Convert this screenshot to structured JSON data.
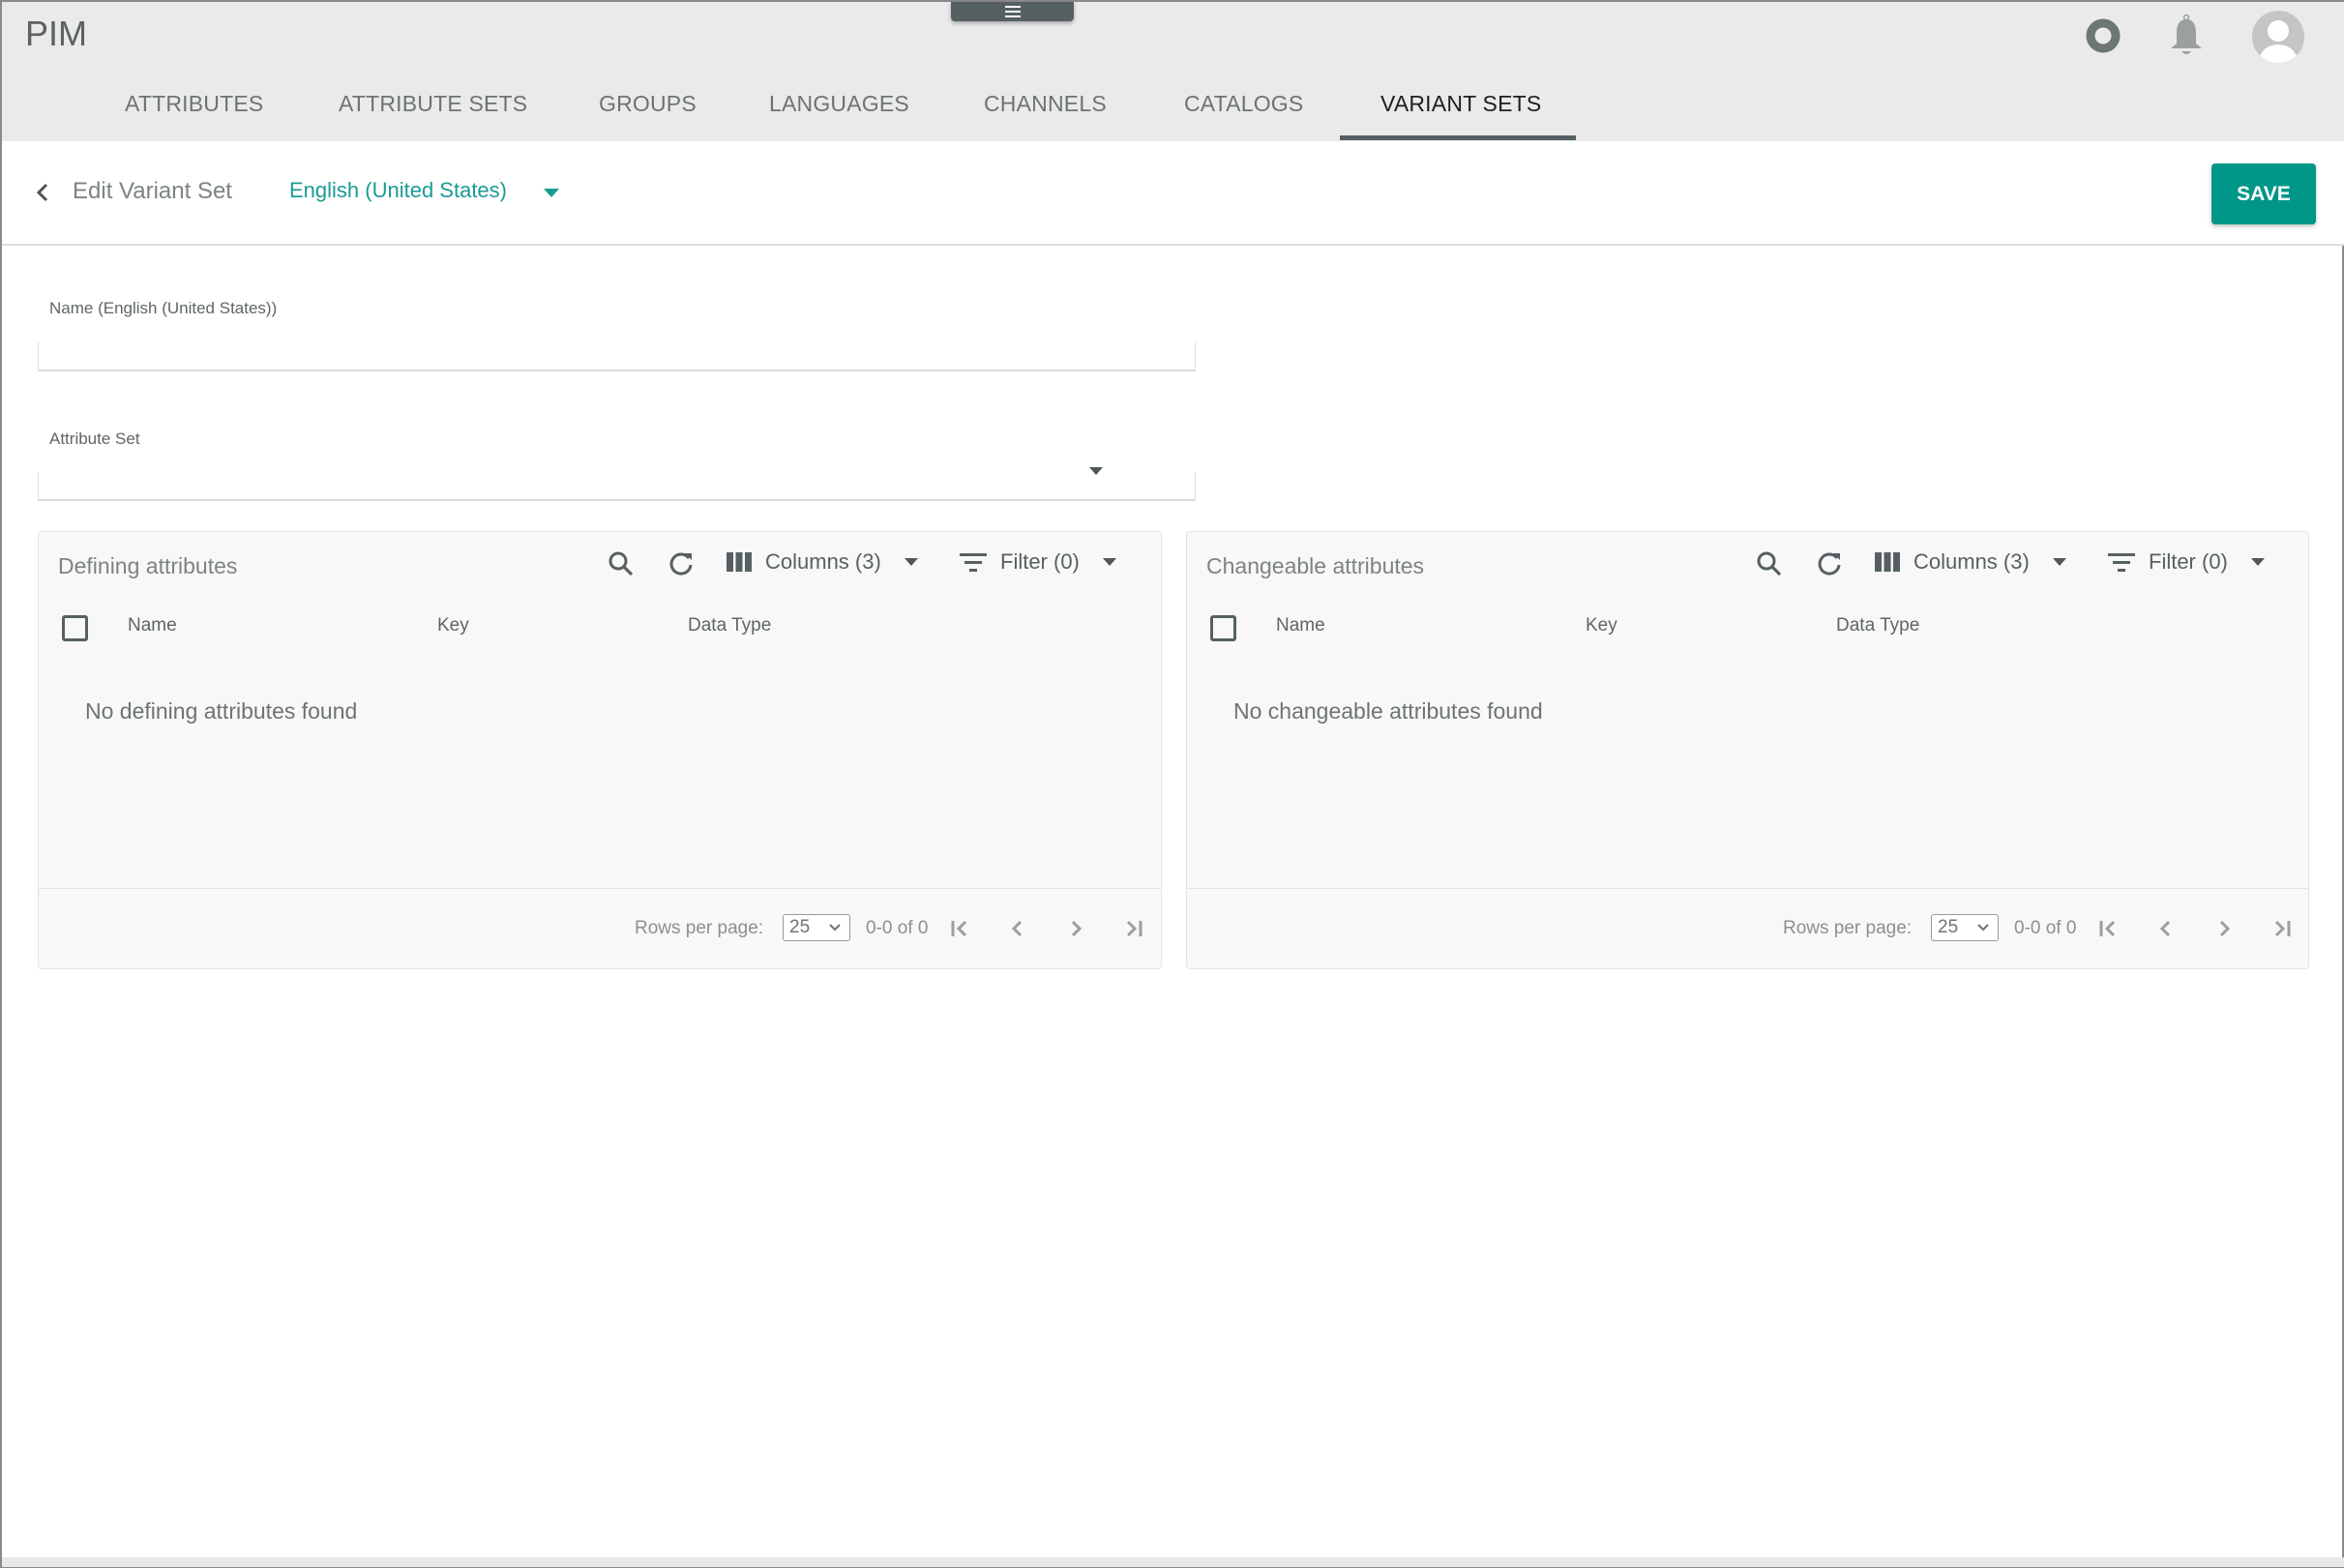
{
  "app": {
    "title": "PIM",
    "menu_handle_icon": "hamburger-icon",
    "top_icons": [
      "status-circle-icon",
      "notification-bell-icon",
      "user-avatar-icon"
    ]
  },
  "tabs": [
    {
      "label": "ATTRIBUTES",
      "active": false
    },
    {
      "label": "ATTRIBUTE SETS",
      "active": false
    },
    {
      "label": "GROUPS",
      "active": false
    },
    {
      "label": "LANGUAGES",
      "active": false
    },
    {
      "label": "CHANNELS",
      "active": false
    },
    {
      "label": "CATALOGS",
      "active": false
    },
    {
      "label": "VARIANT SETS",
      "active": true
    }
  ],
  "subheader": {
    "title": "Edit Variant Set",
    "language": "English (United States)",
    "save_label": "SAVE"
  },
  "colors": {
    "accent": "#009688",
    "accent_text": "#1a9b94",
    "header_bg": "#eaeaea",
    "active_tab_underline": "#566062"
  },
  "form": {
    "name_label": "Name (English (United States))",
    "name_value": "",
    "attribute_set_label": "Attribute Set",
    "attribute_set_value": ""
  },
  "panels": [
    {
      "title": "Defining attributes",
      "columns_label": "Columns (3)",
      "filter_label": "Filter (0)",
      "headers": [
        "Name",
        "Key",
        "Data Type"
      ],
      "rows": [],
      "empty_message": "No defining attributes found",
      "rows_per_page_label": "Rows per page:",
      "rows_per_page": "25",
      "range": "0-0 of 0"
    },
    {
      "title": "Changeable attributes",
      "columns_label": "Columns (3)",
      "filter_label": "Filter (0)",
      "headers": [
        "Name",
        "Key",
        "Data Type"
      ],
      "rows": [],
      "empty_message": "No changeable attributes found",
      "rows_per_page_label": "Rows per page:",
      "rows_per_page": "25",
      "range": "0-0 of 0"
    }
  ]
}
